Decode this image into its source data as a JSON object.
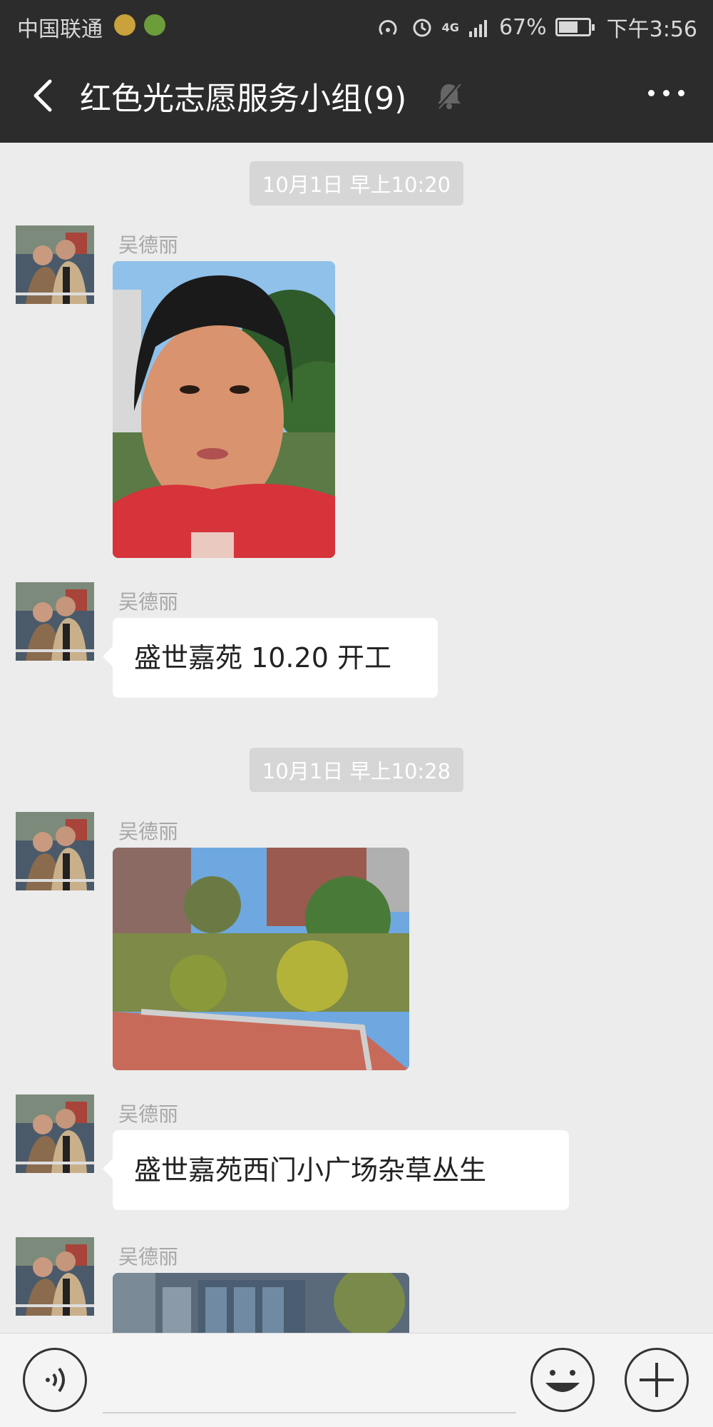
{
  "status_bar": {
    "carrier": "中国联通",
    "battery_percent": "67%",
    "battery_level": 0.67,
    "time": "下午3:56",
    "network": "4G",
    "icons": [
      "sim-message-icon",
      "sim-app-icon",
      "hotspot-icon",
      "alarm-icon",
      "signal-icon",
      "battery-icon"
    ]
  },
  "header": {
    "title": "红色光志愿服务小组(9)",
    "icons": [
      "back-icon",
      "mute-icon",
      "more-icon"
    ]
  },
  "messages": [
    {
      "type": "time",
      "text": "10月1日 早上10:20"
    },
    {
      "type": "image",
      "sender": "吴德丽",
      "content": "selfie photo of a girl in red jacket"
    },
    {
      "type": "text",
      "sender": "吴德丽",
      "text": "盛世嘉苑 10.20 开工"
    },
    {
      "type": "time",
      "text": "10月1日 早上10:28"
    },
    {
      "type": "image",
      "sender": "吴德丽",
      "content": "photo of overgrown weeds in a small plaza"
    },
    {
      "type": "text",
      "sender": "吴德丽",
      "text": "盛世嘉苑西门小广场杂草丛生"
    },
    {
      "type": "image",
      "sender": "吴德丽",
      "content": "partially visible photo of a building"
    }
  ],
  "input_bar": {
    "icons": [
      "voice-icon",
      "emoji-icon",
      "plus-icon"
    ]
  },
  "colors": {
    "header_bg": "#2c2c2c",
    "chat_bg": "#ececec",
    "time_chip_bg": "#d6d6d6",
    "sender_name": "#a7a7a7"
  }
}
